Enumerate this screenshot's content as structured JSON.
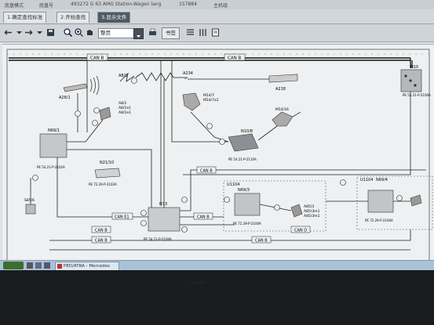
{
  "menu": {
    "items": [
      "底盘模式",
      "底盘号",
      "493272 G 63 AMG Station-Wagen lang",
      "157884",
      "主机组"
    ]
  },
  "tabs": [
    {
      "label": "1.确定查找标准"
    },
    {
      "label": "2.开始查找"
    },
    {
      "label": "3.显示文件"
    }
  ],
  "toolbar": {
    "search_value": "整页",
    "bookmark_label": "书签"
  },
  "diagram": {
    "components": {
      "a261": "A26/1",
      "a81": "A8/1",
      "a234": "A234",
      "a218": "A218",
      "n10": "N10",
      "a81b": "A8/1",
      "a81c": "A8/1e1",
      "a81d": "A8/1e1",
      "m147": "M14/7",
      "m147a": "M14/7a1",
      "m1416": "M14/16",
      "n101": "N10/8",
      "n691": "N69/1",
      "n211": "N21/10",
      "n73": "N73",
      "u1104": "U1104",
      "n693": "N69/3",
      "a853": "A85/3",
      "a853a": "A85/3m1",
      "a853b": "A85/3m1",
      "u1104b": "U1104",
      "n694": "N69/4",
      "s85": "S85/6"
    },
    "bus": {
      "canb": "CAN B",
      "cane1": "CAN E1",
      "cand": "CAN D"
    },
    "refs": {
      "r1": "PE 54.21-P-2100A",
      "r2": "PE 54.21-P-2102A",
      "r3": "PE 72.29-P-2102A",
      "r4": "PE 54.21-P-2100A",
      "r5": "PE 54.21-P-2110A",
      "r6": "PE 72.29-P-2100A",
      "r7": "PE 72.29-P-2100A"
    }
  },
  "taskbar": {
    "item_label": "PED/ATRA - Mercedes"
  },
  "bezel": {
    "brand": "acer"
  }
}
